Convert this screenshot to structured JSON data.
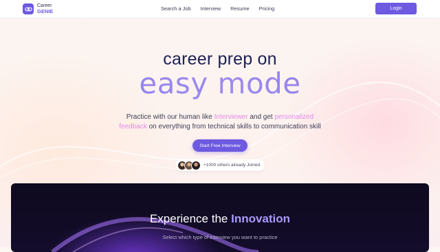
{
  "brand": {
    "line1": "Career",
    "line2": "GENIE",
    "icon": "link-icon",
    "color": "#6d5ae0"
  },
  "nav": {
    "items": [
      "Search a Job",
      "Interview",
      "Resume",
      "Pricing"
    ],
    "login_label": "Login"
  },
  "hero": {
    "line1": "career prep on",
    "line2": "easy mode",
    "sub_a": "Practice with our human like ",
    "sub_hl1": "Interviewer",
    "sub_b": " and get ",
    "sub_hl2": "personalized",
    "sub_hl3": "feedback",
    "sub_c": " on everything from technical skills to communication skill",
    "cta_label": "Start Free Interview",
    "joined_text": "+1000 others already Joined"
  },
  "panel": {
    "title_a": "Experience the ",
    "title_b": "Innovation",
    "subtitle": "Select which type of interview you want to practice"
  }
}
